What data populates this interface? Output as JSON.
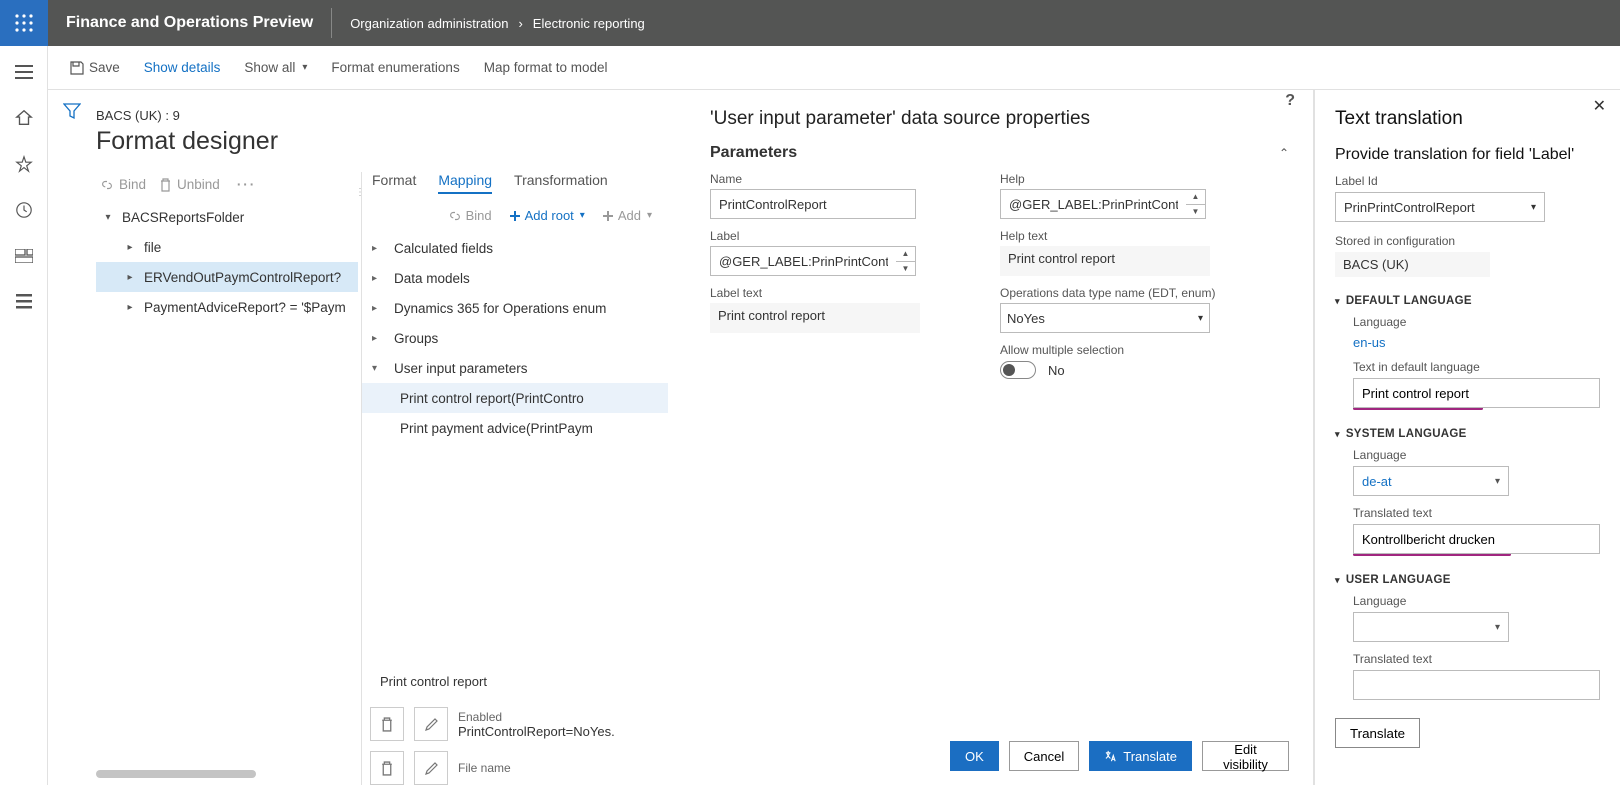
{
  "app": {
    "title": "Finance and Operations Preview"
  },
  "breadcrumb": {
    "items": [
      "Organization administration",
      "Electronic reporting"
    ]
  },
  "commandBar": {
    "save": "Save",
    "showDetails": "Show details",
    "showAll": "Show all",
    "formatEnum": "Format enumerations",
    "mapFormat": "Map format to model"
  },
  "crumb": "BACS (UK) : 9",
  "pageTitle": "Format designer",
  "leftToolbar": {
    "bind": "Bind",
    "unbind": "Unbind"
  },
  "leftTree": {
    "root": "BACSReportsFolder",
    "items": [
      "file",
      "ERVendOutPaymControlReport?",
      "PaymentAdviceReport? = '$Paym"
    ]
  },
  "tabs": {
    "format": "Format",
    "mapping": "Mapping",
    "trans": "Transformation"
  },
  "midToolbar": {
    "bind": "Bind",
    "addRoot": "Add root",
    "add": "Add"
  },
  "dsTree": {
    "items": [
      "Calculated fields",
      "Data models",
      "Dynamics 365 for Operations enum",
      "Groups"
    ],
    "uip": "User input parameters",
    "children": [
      "Print control report(PrintContro",
      "Print payment advice(PrintPaym"
    ]
  },
  "bottom": {
    "title": "Print control report",
    "enabled_lbl": "Enabled",
    "enabled_val": "PrintControlReport=NoYes.",
    "filename_lbl": "File name"
  },
  "dialog": {
    "title": "'User input parameter' data source properties",
    "section": "Parameters",
    "name_lbl": "Name",
    "name_val": "PrintControlReport",
    "label_lbl": "Label",
    "label_val": "@GER_LABEL:PrinPrintContro",
    "labeltext_lbl": "Label text",
    "labeltext_val": "Print control report",
    "help_lbl": "Help",
    "help_val": "@GER_LABEL:PrinPrintContro",
    "helptext_lbl": "Help text",
    "helptext_val": "Print control report",
    "edt_lbl": "Operations data type name (EDT, enum)",
    "edt_val": "NoYes",
    "multi_lbl": "Allow multiple selection",
    "multi_val": "No",
    "ok": "OK",
    "cancel": "Cancel",
    "translate": "Translate",
    "edit": "Edit visibility"
  },
  "right": {
    "title": "Text translation",
    "subtitle": "Provide translation for field 'Label'",
    "labelid_lbl": "Label Id",
    "labelid_val": "PrinPrintControlReport",
    "stored_lbl": "Stored in configuration",
    "stored_val": "BACS (UK)",
    "g_default": "DEFAULT LANGUAGE",
    "lang_lbl": "Language",
    "lang_def": "en-us",
    "text_def_lbl": "Text in default language",
    "text_def_val": "Print control report",
    "g_system": "SYSTEM LANGUAGE",
    "lang_sys": "de-at",
    "trans_text_lbl": "Translated text",
    "trans_text_val": "Kontrollbericht drucken",
    "g_user": "USER LANGUAGE",
    "translate_btn": "Translate"
  }
}
